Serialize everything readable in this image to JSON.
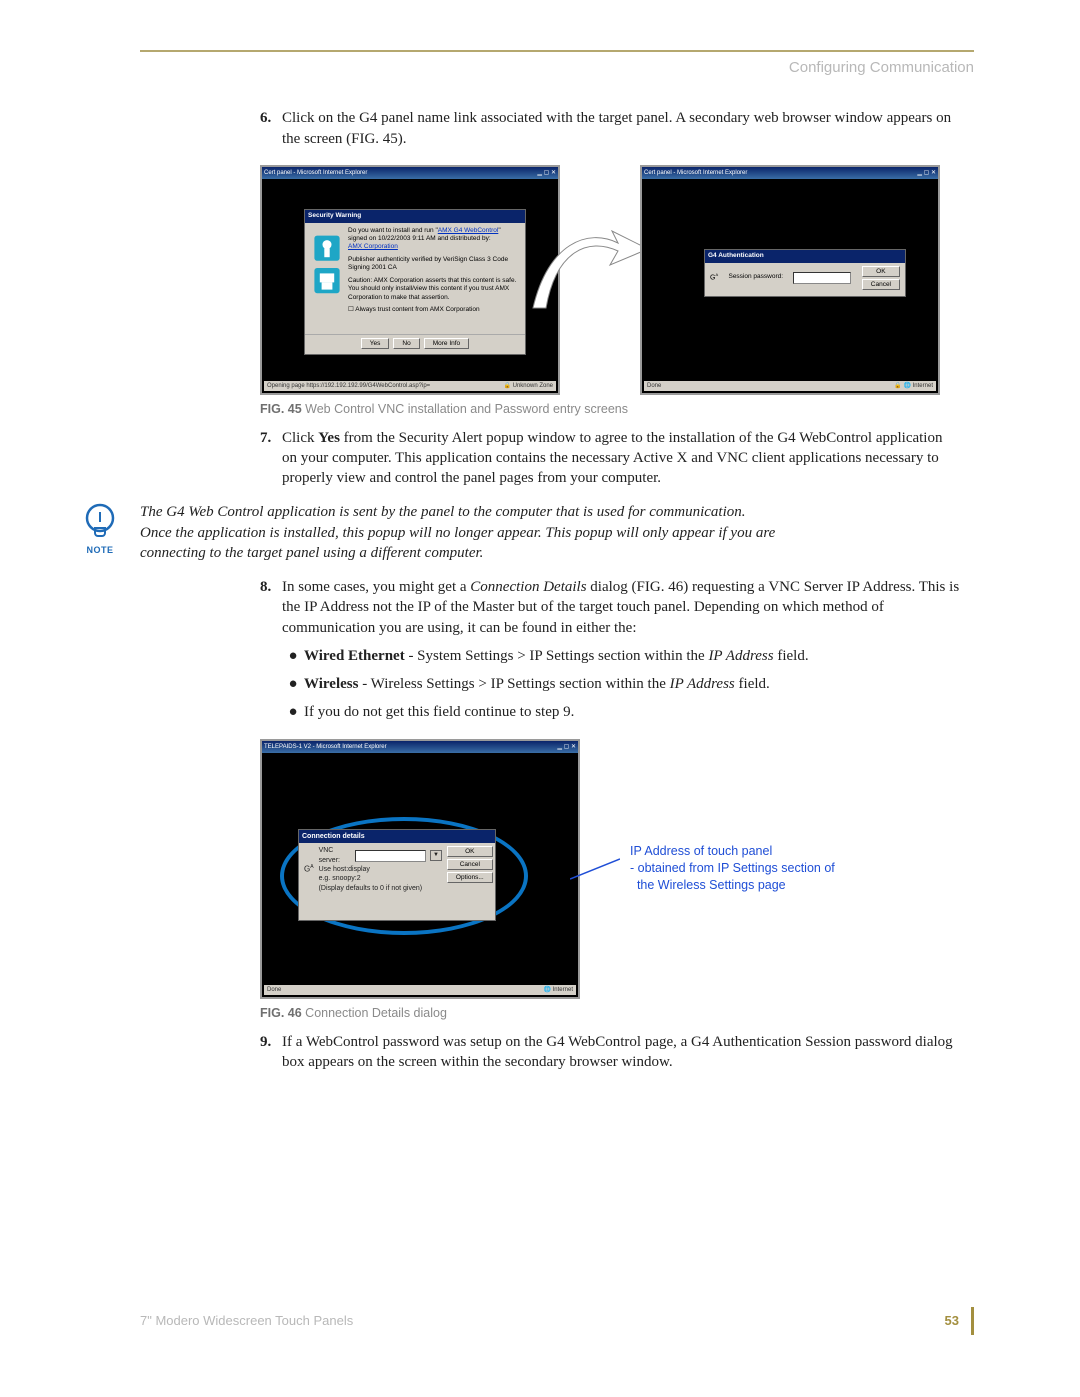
{
  "header": {
    "section_title": "Configuring Communication"
  },
  "items": {
    "6": {
      "num": "6.",
      "text": "Click on the G4 panel name link associated with the target panel. A secondary web browser window appears on the screen (FIG. 45)."
    },
    "7": {
      "num": "7.",
      "click": "Click ",
      "yes": "Yes",
      "rest": " from the Security Alert popup window to agree to the installation of the G4 WebControl application on your computer. This application contains the necessary Active X and VNC client applications necessary to properly view and control the panel pages from your computer."
    },
    "8": {
      "num": "8.",
      "pre": "In some cases, you might get a ",
      "cd": "Connection Details",
      "mid": " dialog (FIG. 46) requesting a VNC Server IP Address. This is the IP Address not the IP of the Master but of the target touch panel. Depending on which method of communication you are using, it can be found in either the:"
    },
    "9": {
      "num": "9.",
      "text": "If a WebControl password was setup on the G4 WebControl page, a G4 Authentication Session password dialog box appears on the screen within the secondary browser window."
    }
  },
  "fig45": {
    "caption_label": "FIG. 45",
    "caption_text": "  Web Control VNC installation and Password entry screens"
  },
  "fig46": {
    "caption_label": "FIG. 46",
    "caption_text": "  Connection Details dialog",
    "annotation_line1": "IP Address of touch panel",
    "annotation_line2": "- obtained from IP Settings section of",
    "annotation_line3": "  the Wireless Settings page"
  },
  "note": {
    "label": "NOTE",
    "text": "The G4 Web Control application is sent by the panel to the computer that is used for communication. Once the application is installed, this popup will no longer appear. This popup will only appear if you are connecting to the target panel using a different computer."
  },
  "bullets": {
    "wired_b": "Wired Ethernet",
    "wired_rest": " - System Settings > IP Settings section within the ",
    "wired_field": "IP Address",
    "wired_tail": " field.",
    "wireless_b": "Wireless",
    "wireless_rest": " - Wireless Settings > IP Settings section within the ",
    "wireless_field": "IP Address",
    "wireless_tail": " field.",
    "noget": "If you do not get this field continue to step 9."
  },
  "dialog1": {
    "title_left": "Cert panel - Microsoft Internet Explorer",
    "title_right": "Cert panel - Microsoft Internet Explorer",
    "sec_title": "Security Warning",
    "sec_line1a": "Do you want to install and run \"",
    "sec_link1": "AMX G4 WebControl",
    "sec_line1b": "\" signed on 10/22/2003 9:11 AM and distributed by:",
    "sec_link2": "AMX Corporation",
    "sec_line2": "Publisher authenticity verified by VeriSign Class 3 Code Signing 2001 CA",
    "sec_line3": "Caution: AMX Corporation asserts that this content is safe. You should only install/view this content if you trust AMX Corporation to make that assertion.",
    "sec_check": "Always trust content from AMX Corporation",
    "btn_yes": "Yes",
    "btn_no": "No",
    "btn_more": "More Info",
    "status_left": "Opening page https://192.192.192.99/G4WebControl.asp?ip=",
    "status_right_zone": "Unknown Zone",
    "status_done": "Done",
    "status_internet": "Internet",
    "auth_title": "G4 Authentication",
    "auth_label": "Session password:",
    "btn_ok": "OK",
    "btn_cancel": "Cancel"
  },
  "dialog2": {
    "ie_title": "TELEPAIDS-1 V2 - Microsoft Internet Explorer",
    "title": "Connection details",
    "vnc": "VNC server:",
    "hint1": "Use host:display",
    "hint2": "e.g. snoopy:2",
    "hint3": "(Display defaults to 0 if not given)",
    "btn_ok": "OK",
    "btn_cancel": "Cancel",
    "btn_options": "Options...",
    "status_done": "Done",
    "status_internet": "Internet"
  },
  "footer": {
    "doc": "7\" Modero Widescreen Touch Panels",
    "page": "53"
  }
}
